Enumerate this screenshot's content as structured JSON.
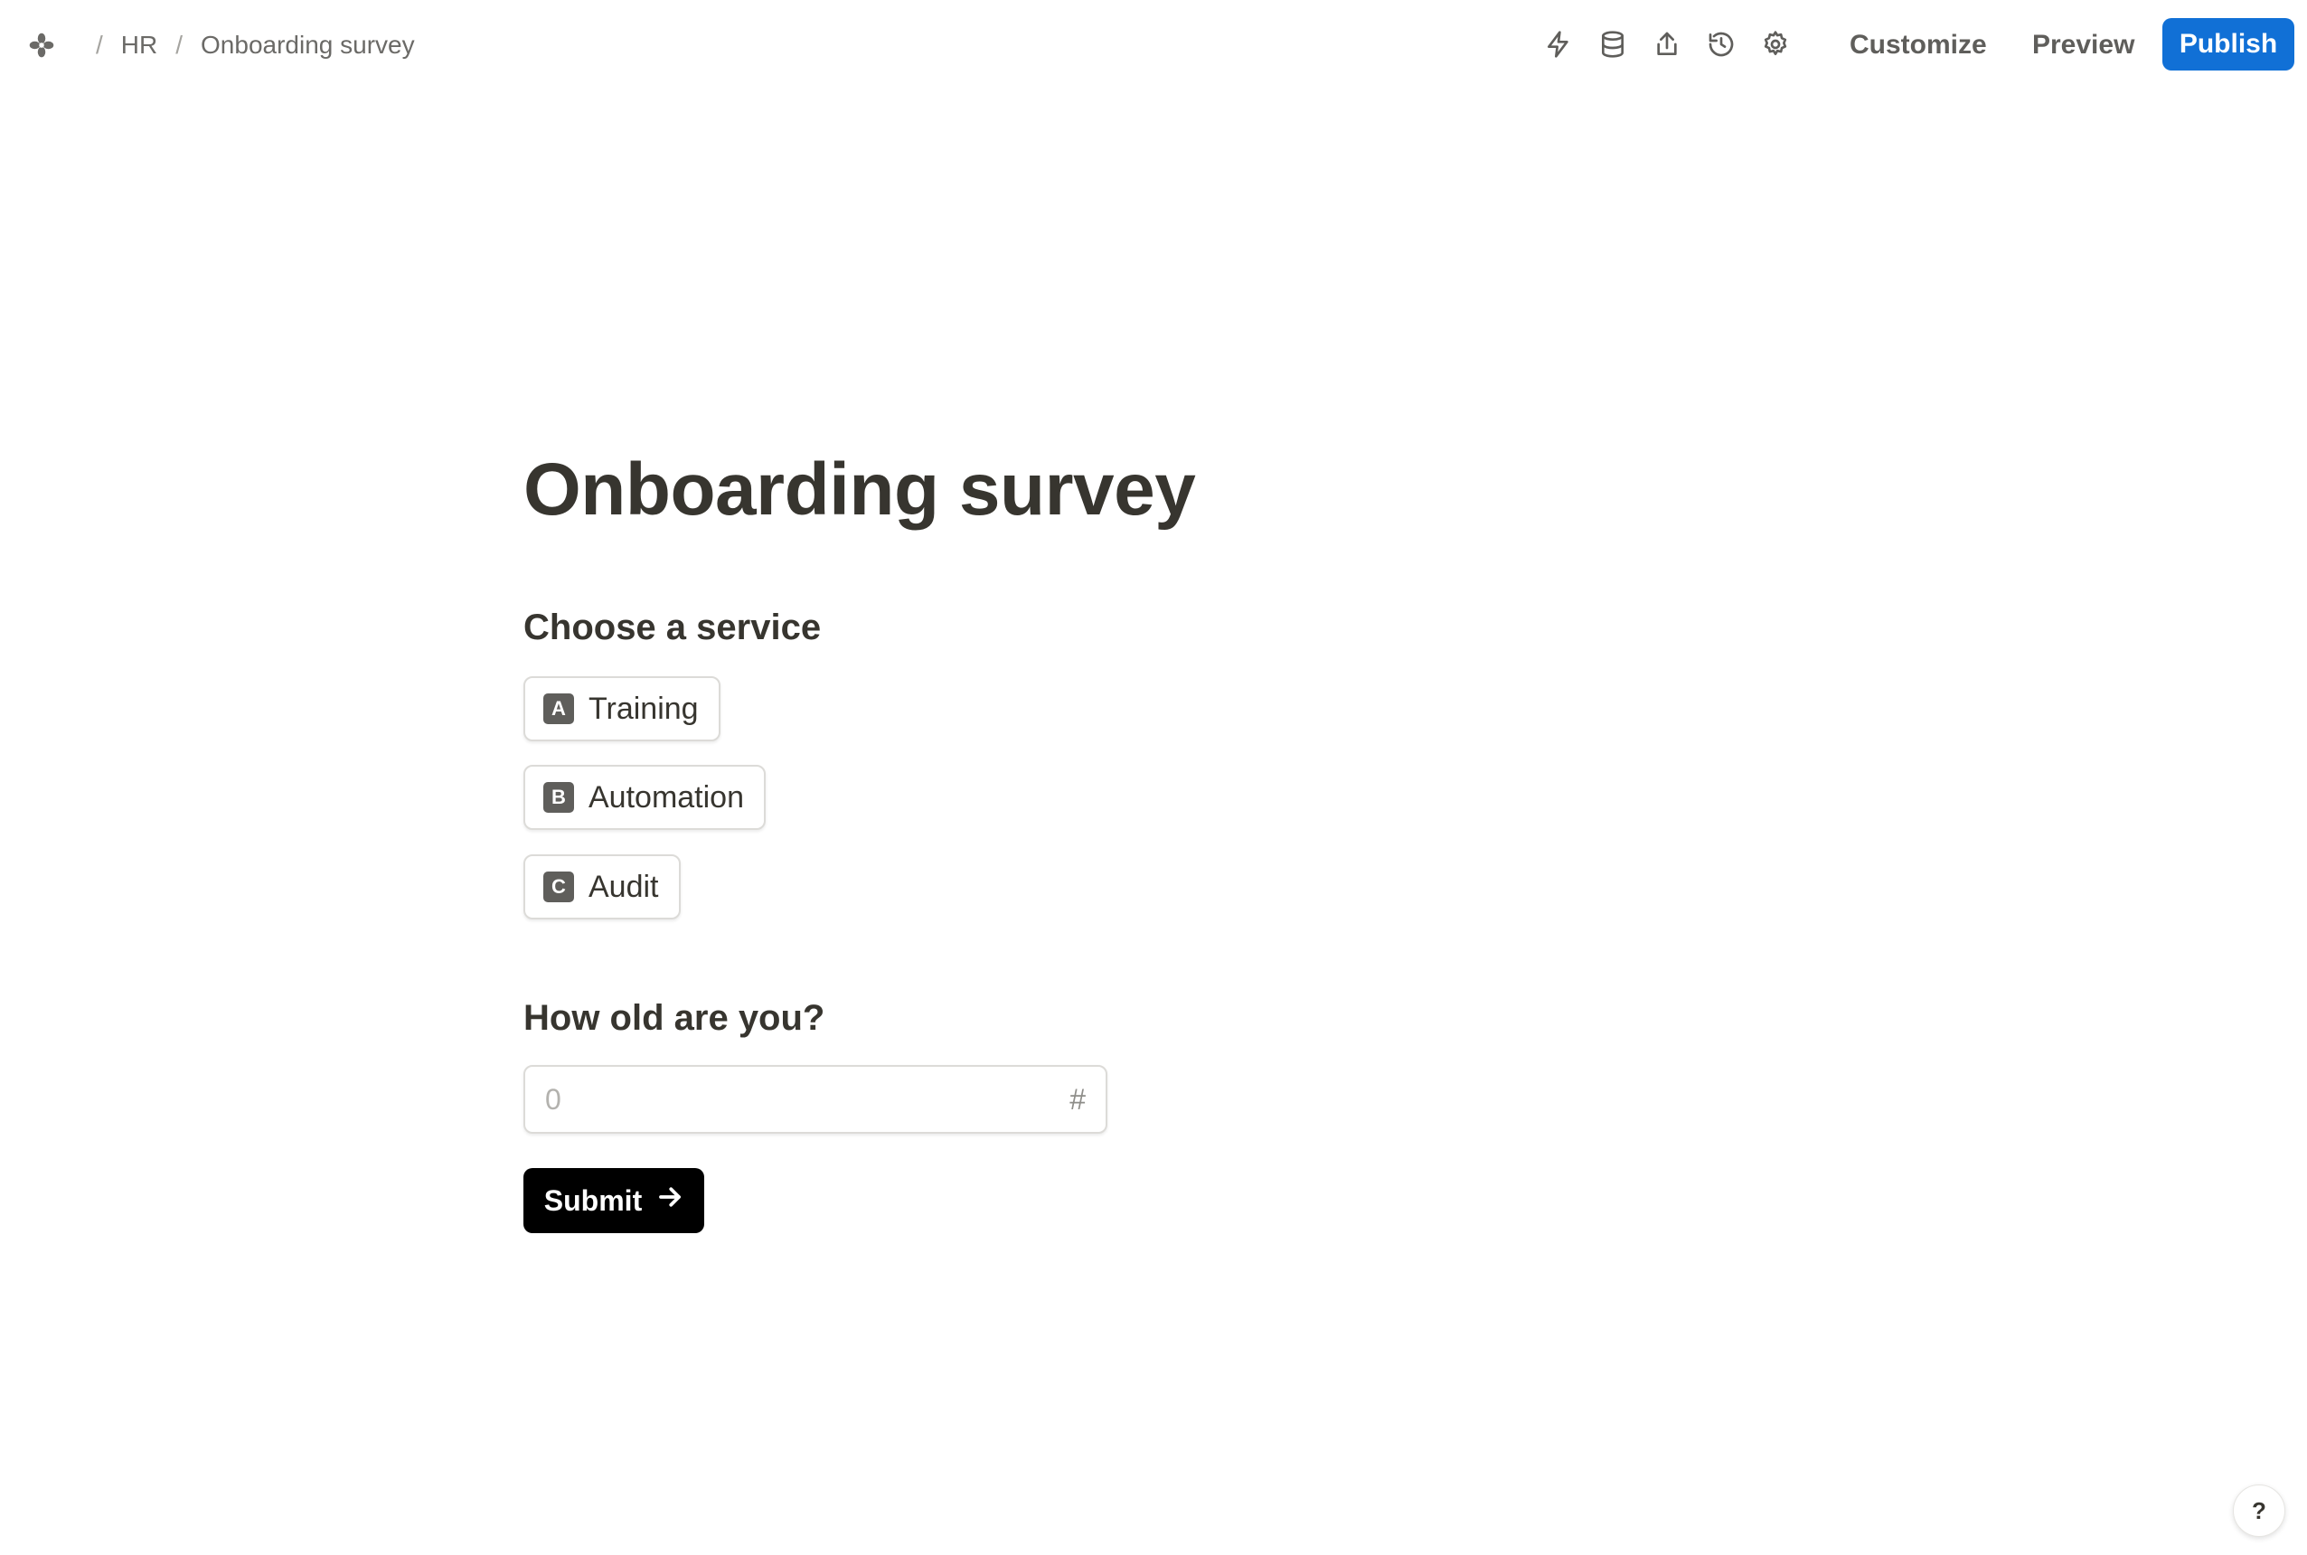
{
  "header": {
    "logo_icon": "pinwheel-logo-icon",
    "breadcrumb": [
      {
        "label": "HR"
      },
      {
        "label": "Onboarding survey"
      }
    ],
    "breadcrumb_separator": "/",
    "toolbar_icons": [
      "lightning-icon",
      "database-icon",
      "share-icon",
      "history-icon",
      "settings-icon"
    ],
    "customize_label": "Customize",
    "preview_label": "Preview",
    "publish_label": "Publish",
    "publish_color": "#1170d6"
  },
  "form": {
    "title": "Onboarding survey",
    "questions": [
      {
        "title": "Choose a service",
        "type": "single-choice",
        "options": [
          {
            "key": "A",
            "label": "Training"
          },
          {
            "key": "B",
            "label": "Automation"
          },
          {
            "key": "C",
            "label": "Audit"
          }
        ]
      },
      {
        "title": "How old are you?",
        "type": "number",
        "placeholder": "0",
        "value": "",
        "input_icon": "#"
      }
    ],
    "submit_label": "Submit",
    "submit_icon": "arrow-right-icon"
  },
  "help": {
    "label": "?"
  }
}
